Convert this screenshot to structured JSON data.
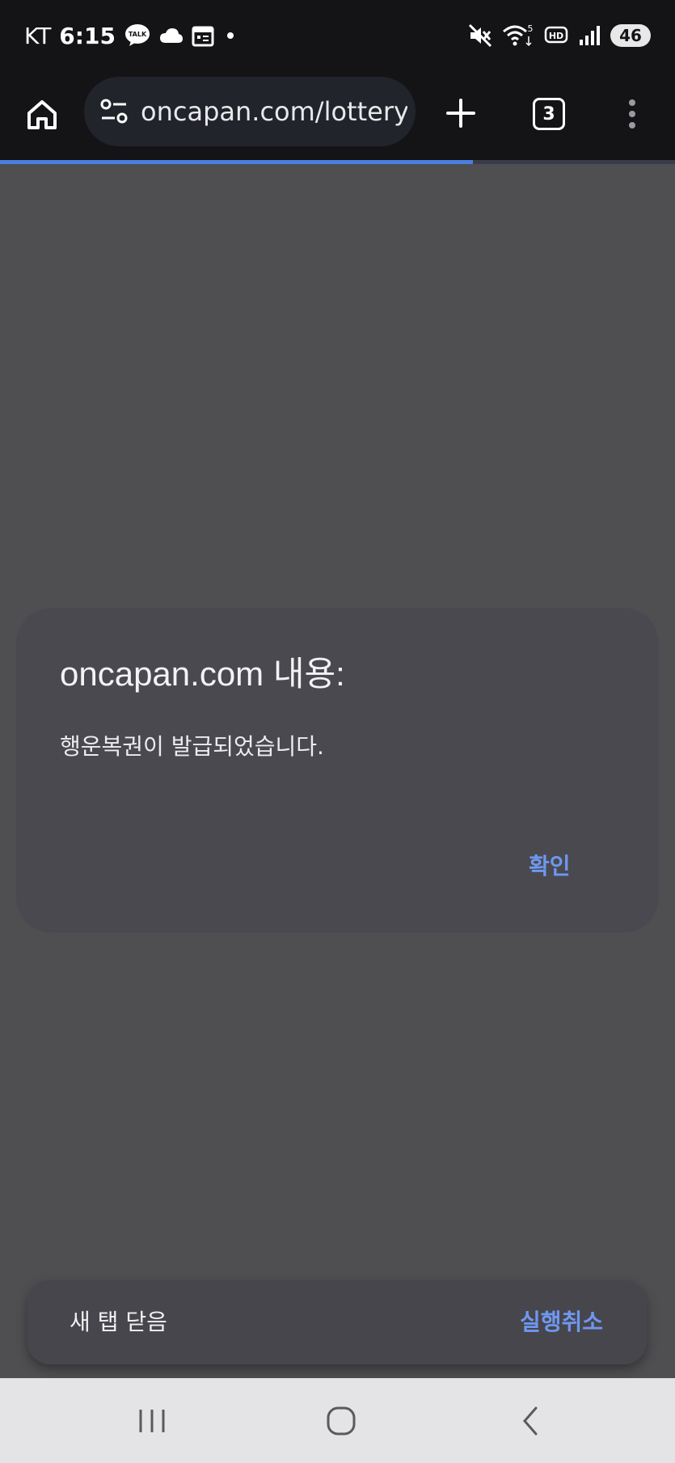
{
  "status_bar": {
    "carrier": "KT",
    "time": "6:15",
    "talk_badge": "TALK",
    "hd_badge": "HD",
    "wifi_badge": "5",
    "battery": "46"
  },
  "browser": {
    "url": "oncapan.com/lottery",
    "tab_count": "3",
    "load_progress_percent": 70
  },
  "dialog": {
    "title": "oncapan.com 내용:",
    "message": "행운복권이 발급되었습니다.",
    "ok_label": "확인"
  },
  "snackbar": {
    "text": "새 탭 닫음",
    "action": "실행취소"
  },
  "colors": {
    "accent": "#4a7fe0",
    "link": "#6f97ef",
    "page_bg": "#4f4f51",
    "dialog_bg": "#4a494f",
    "toolbar_bg": "#141417"
  }
}
